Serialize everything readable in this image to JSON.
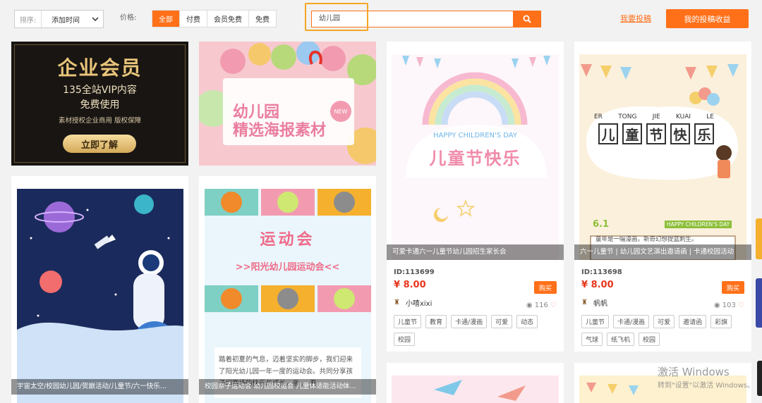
{
  "toolbar": {
    "sort_label": "排序:",
    "sort_value": "添加时间",
    "price_label": "价格:",
    "price_tabs": [
      "全部",
      "付费",
      "会员免费",
      "免费"
    ],
    "search_value": "幼儿园",
    "contribute_link": "我要投稿",
    "earnings_button": "我的投稿收益"
  },
  "banner_vip": {
    "title": "企业会员",
    "line1": "135全站VIP内容",
    "line2": "免费使用",
    "line3": "素材授权企业商用 版权保障",
    "cta": "立即了解"
  },
  "banner_kinder": {
    "line1": "幼儿园",
    "line2": "精选海报素材",
    "badge": "NEW"
  },
  "card_space": {
    "caption": "宇宙太空/校园幼儿园/贺巅活动/儿童节/六一快乐..."
  },
  "card_sports": {
    "title": "运动会",
    "subtitle": ">>阳光幼儿园运动会<<",
    "body": "踏着初夏的气息，迈着坚实的脚步，我们迎来了阳光幼儿园一年一度的运动会。共同分享孩子们赛场的快乐与成长，亲 ... 看",
    "caption": "校园亲子运动会 幼儿园校运会 儿童体适能活动体..."
  },
  "card_rainbow": {
    "img_en": "HAPPY CHILDREN'S DAY",
    "img_cn": "儿童节快乐",
    "caption": "可爱卡通六一儿童节幼儿园招生家长会",
    "id": "ID:113699",
    "price": "¥ 8.00",
    "buy": "购买",
    "author": "小嘻xixi",
    "views": "116",
    "tags": [
      "儿童节",
      "教育",
      "卡通/漫画",
      "可爱",
      "动态",
      "校园"
    ]
  },
  "card_festival": {
    "pinyin": [
      "ER",
      "TONG",
      "JIE",
      "KUAI",
      "LE"
    ],
    "chars": [
      "儿",
      "童",
      "节",
      "快",
      "乐"
    ],
    "date": "6.1",
    "date_en": "HAPPY CHILDREN'S DAY",
    "img_text": "童年是一幅漫画，新奇幻想提篮刺生。",
    "caption": "六一儿童节 | 幼儿园文艺演出邀请函 | 卡通校园活动",
    "id": "ID:113698",
    "price": "¥ 8.00",
    "buy": "购买",
    "author": "帆帆",
    "views": "103",
    "tags": [
      "儿童节",
      "卡通/漫画",
      "可爱",
      "邀请函",
      "彩旗",
      "气球",
      "纸飞机",
      "校园"
    ]
  },
  "watermark": {
    "line1": "激活 Windows",
    "line2": "转到\"设置\"以激活 Windows。"
  },
  "colors": {
    "accent": "#ff7019",
    "price": "#e8351c",
    "highlight": "#f5a623"
  }
}
